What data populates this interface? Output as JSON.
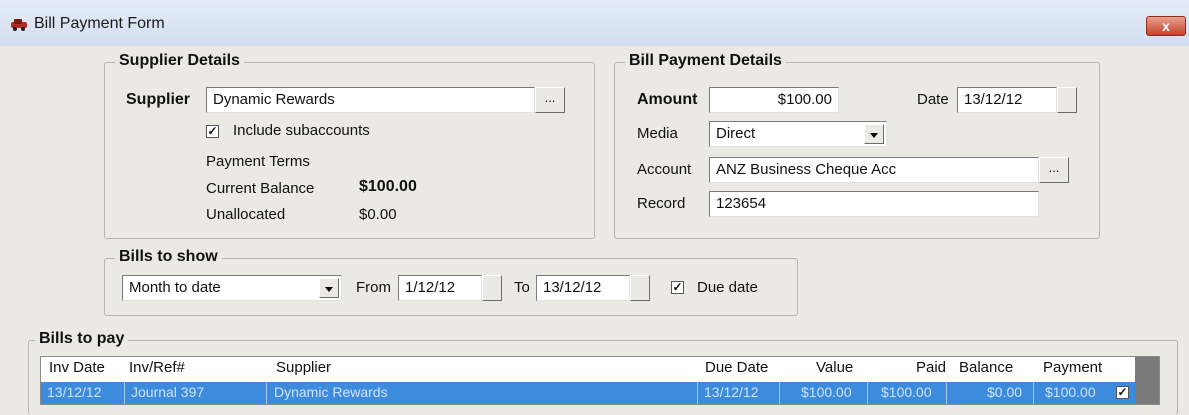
{
  "window": {
    "title": "Bill Payment Form",
    "close_glyph": "x",
    "icon": "app-car-icon"
  },
  "supplier_details": {
    "legend": "Supplier Details",
    "supplier_label": "Supplier",
    "supplier_value": "Dynamic Rewards",
    "browse_label": "...",
    "include_subaccounts_label": "Include subaccounts",
    "include_subaccounts_checked": true,
    "payment_terms_label": "Payment Terms",
    "current_balance_label": "Current Balance",
    "current_balance_value": "$100.00",
    "unallocated_label": "Unallocated",
    "unallocated_value": "$0.00"
  },
  "payment_details": {
    "legend": "Bill Payment Details",
    "amount_label": "Amount",
    "amount_value": "$100.00",
    "date_label": "Date",
    "date_value": "13/12/12",
    "media_label": "Media",
    "media_value": "Direct",
    "account_label": "Account",
    "account_value": "ANZ Business Cheque Acc",
    "account_browse_label": "...",
    "record_label": "Record",
    "record_value": "123654"
  },
  "bills_to_show": {
    "legend": "Bills to show",
    "period_value": "Month to date",
    "from_label": "From",
    "from_value": "1/12/12",
    "to_label": "To",
    "to_value": "13/12/12",
    "due_date_label": "Due date",
    "due_date_checked": true
  },
  "bills_to_pay": {
    "legend": "Bills to pay",
    "columns": [
      "Inv Date",
      "Inv/Ref#",
      "Supplier",
      "Due Date",
      "Value",
      "Paid",
      "Balance",
      "Payment"
    ],
    "rows": [
      [
        "13/12/12",
        "Journal 397",
        "Dynamic Rewards",
        "13/12/12",
        "$100.00",
        "$100.00",
        "$0.00",
        "$100.00"
      ]
    ],
    "row_checked": true
  },
  "colors": {
    "window_bg": "#ebe9e4",
    "selection": "#3c8bdc",
    "close_button": "#c6432a"
  }
}
